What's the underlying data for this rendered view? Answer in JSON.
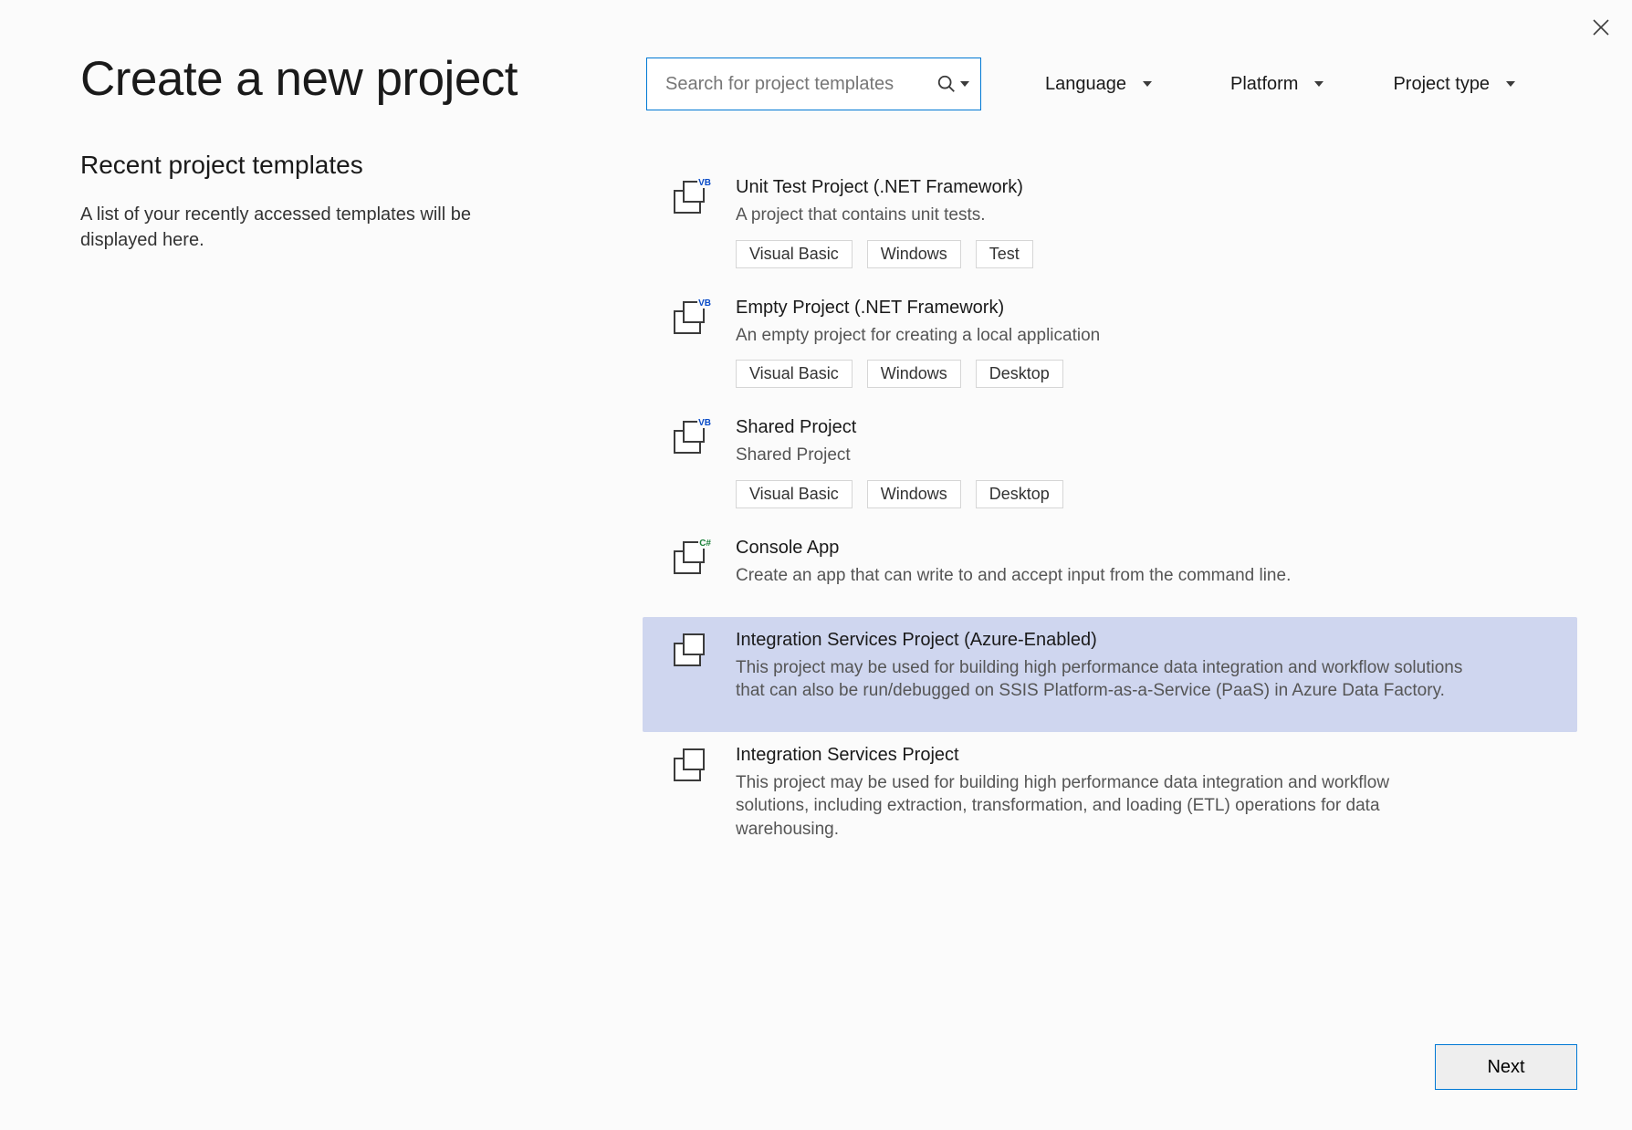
{
  "header": {
    "title": "Create a new project",
    "close_aria": "Close"
  },
  "recent": {
    "title": "Recent project templates",
    "description": "A list of your recently accessed templates will be displayed here."
  },
  "search": {
    "placeholder": "Search for project templates"
  },
  "filters": {
    "language": "Language",
    "platform": "Platform",
    "project_type": "Project type"
  },
  "templates": [
    {
      "title": "Unit Test Project (.NET Framework)",
      "description": "A project that contains unit tests.",
      "tags": [
        "Visual Basic",
        "Windows",
        "Test"
      ],
      "lang_badge": "VB",
      "selected": false,
      "icon_name": "unit-test-vb-icon"
    },
    {
      "title": "Empty Project (.NET Framework)",
      "description": "An empty project for creating a local application",
      "tags": [
        "Visual Basic",
        "Windows",
        "Desktop"
      ],
      "lang_badge": "VB",
      "selected": false,
      "icon_name": "empty-project-vb-icon"
    },
    {
      "title": "Shared Project",
      "description": "Shared Project",
      "tags": [
        "Visual Basic",
        "Windows",
        "Desktop"
      ],
      "lang_badge": "VB",
      "selected": false,
      "icon_name": "shared-project-vb-icon"
    },
    {
      "title": "Console App",
      "description": "Create an app that can write to and accept input from the command line.",
      "tags": [],
      "lang_badge": "C#",
      "selected": false,
      "icon_name": "console-app-csharp-icon"
    },
    {
      "title": "Integration Services Project (Azure-Enabled)",
      "description": "This project may be used for building high performance data integration and workflow solutions that can also be run/debugged on SSIS Platform-as-a-Service (PaaS) in Azure Data Factory.",
      "tags": [],
      "lang_badge": "",
      "selected": true,
      "icon_name": "ssis-azure-project-icon"
    },
    {
      "title": "Integration Services Project",
      "description": "This project may be used for building high performance data integration and workflow solutions, including extraction, transformation, and loading (ETL) operations for data warehousing.",
      "tags": [],
      "lang_badge": "",
      "selected": false,
      "icon_name": "ssis-project-icon"
    }
  ],
  "footer": {
    "next": "Next"
  }
}
